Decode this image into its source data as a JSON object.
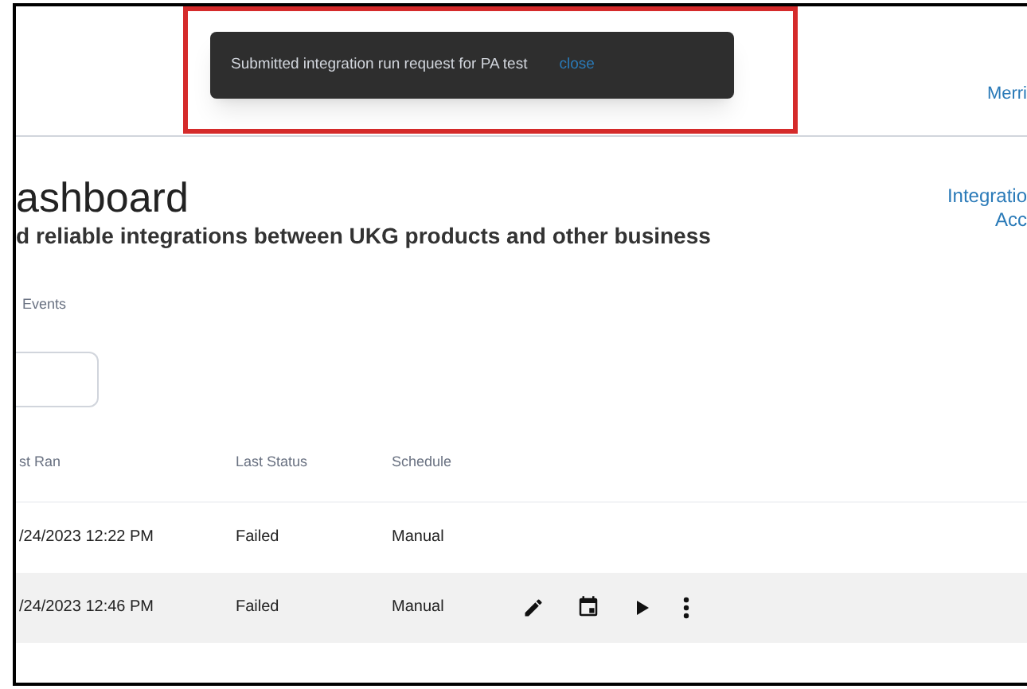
{
  "toast": {
    "message": "Submitted integration run request for PA test",
    "action": "close"
  },
  "header": {
    "user_link": "Merri"
  },
  "page": {
    "title": "ashboard",
    "subtitle": "d reliable integrations between UKG products and other business",
    "side_link": [
      "Integratio",
      "Acc"
    ]
  },
  "tabs": [
    {
      "label": "Events",
      "selected": false
    }
  ],
  "table": {
    "columns": [
      "st Ran",
      "Last Status",
      "Schedule"
    ],
    "rows": [
      {
        "cells": [
          "/24/2023 12:22 PM",
          "Failed",
          "Manual"
        ],
        "highlighted": false
      },
      {
        "cells": [
          "/24/2023 12:46 PM",
          "Failed",
          "Manual"
        ],
        "highlighted": true
      }
    ]
  }
}
